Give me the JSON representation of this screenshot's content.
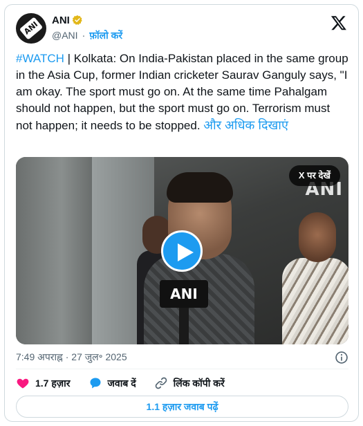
{
  "author": {
    "name": "ANI",
    "handle": "@ANI",
    "separator": "·",
    "follow_label": "फ़ॉलो करें",
    "avatar_text": "ANI",
    "verified_icon": "verified-badge-icon",
    "verified_color": "#e2b719"
  },
  "header": {
    "logo_icon": "x-logo-icon"
  },
  "tweet": {
    "hashtag": "#WATCH",
    "body": " | Kolkata: On India-Pakistan placed in the same group in the Asia Cup, former Indian cricketer Saurav Ganguly says, \"I am okay. The sport must go on. At the same time Pahalgam should not happen, but the sport must go on. Terrorism must not happen; it needs to be stopped.",
    "show_more": "और अधिक दिखाएं"
  },
  "media": {
    "watch_on_x": "X पर देखें",
    "watermark": "ANI",
    "mic_label": "ANI",
    "play_icon": "play-icon"
  },
  "meta": {
    "timestamp": "7:49 अपराह्न · 27 जुल॰ 2025",
    "info_icon": "info-icon"
  },
  "actions": {
    "like_count": "1.7 हज़ार",
    "reply_label": "जवाब दें",
    "copy_link_label": "लिंक कॉपी करें",
    "like_icon": "heart-icon",
    "reply_icon": "speech-bubble-icon",
    "link_icon": "link-icon"
  },
  "footer": {
    "read_replies": "1.1 हज़ार जवाब पढ़ें"
  },
  "colors": {
    "accent": "#1d9bf0",
    "like": "#f91880",
    "text": "#0f1419",
    "muted": "#536471"
  }
}
